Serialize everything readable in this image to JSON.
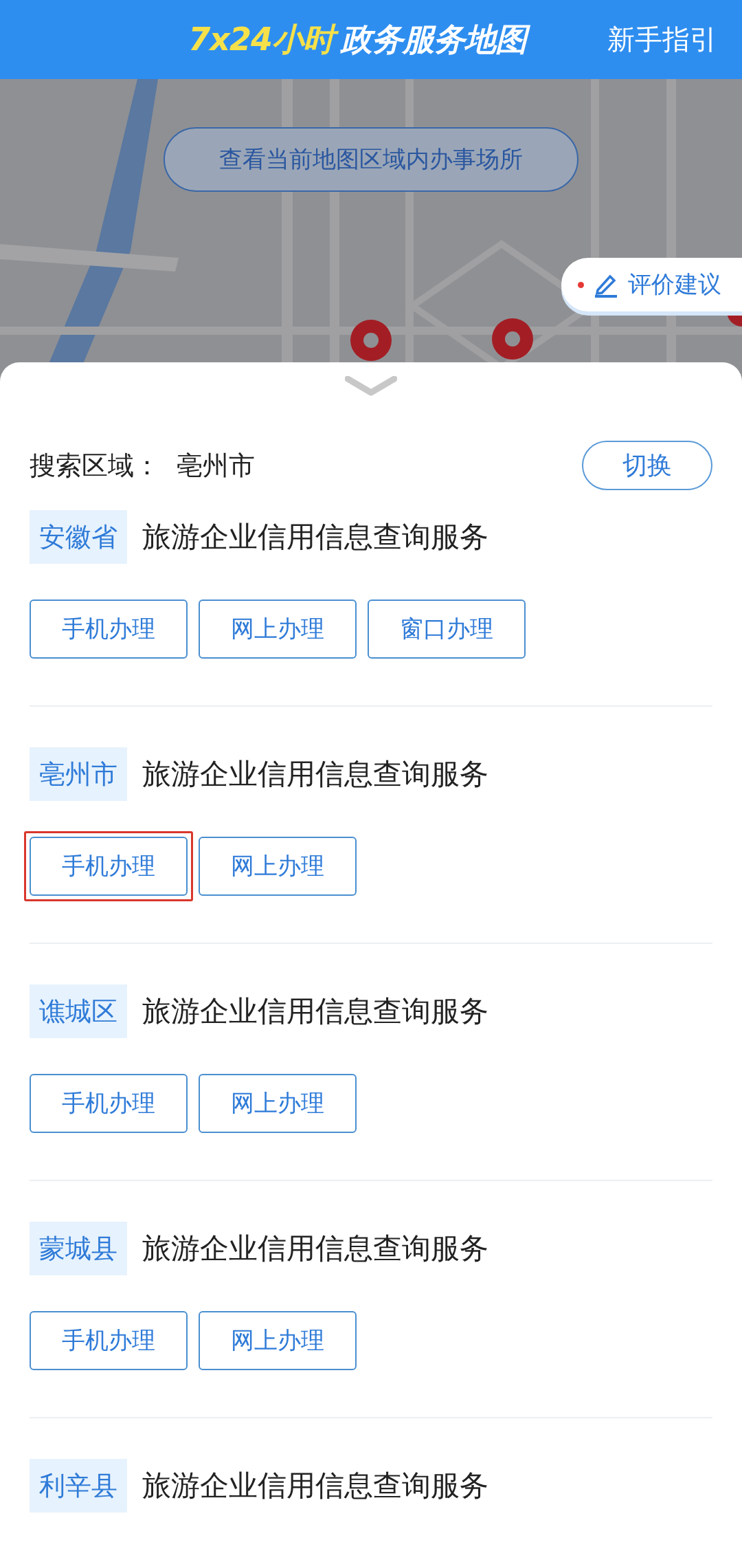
{
  "header": {
    "title_accent": "7x24小时",
    "title_main": "政务服务地图",
    "guide_link": "新手指引"
  },
  "map": {
    "kind": "picture",
    "area_button": "查看当前地图区域内办事场所",
    "feedback_button": "评价建议"
  },
  "search": {
    "label": "搜索区域：",
    "region": "亳州市",
    "switch_button": "切换"
  },
  "services": [
    {
      "region": "安徽省",
      "name": "旅游企业信用信息查询服务",
      "actions": [
        {
          "label": "手机办理",
          "highlighted": false
        },
        {
          "label": "网上办理",
          "highlighted": false
        },
        {
          "label": "窗口办理",
          "highlighted": false
        }
      ]
    },
    {
      "region": "亳州市",
      "name": "旅游企业信用信息查询服务",
      "actions": [
        {
          "label": "手机办理",
          "highlighted": true
        },
        {
          "label": "网上办理",
          "highlighted": false
        }
      ]
    },
    {
      "region": "谯城区",
      "name": "旅游企业信用信息查询服务",
      "actions": [
        {
          "label": "手机办理",
          "highlighted": false
        },
        {
          "label": "网上办理",
          "highlighted": false
        }
      ]
    },
    {
      "region": "蒙城县",
      "name": "旅游企业信用信息查询服务",
      "actions": [
        {
          "label": "手机办理",
          "highlighted": false
        },
        {
          "label": "网上办理",
          "highlighted": false
        }
      ]
    },
    {
      "region": "利辛县",
      "name": "旅游企业信用信息查询服务"
    }
  ]
}
